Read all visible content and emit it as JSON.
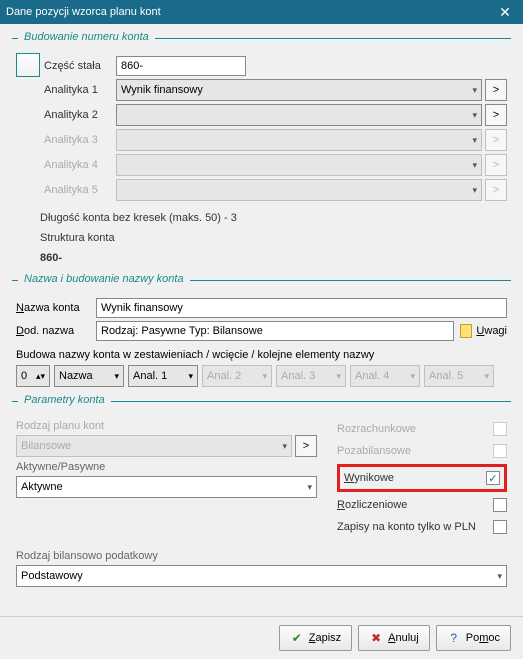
{
  "window": {
    "title": "Dane pozycji wzorca planu kont",
    "close": "✕"
  },
  "sec_build": {
    "legend": "Budowanie numeru konta",
    "const_lbl": "Część stała",
    "const_val": "860-",
    "ana1_lbl": "Analityka 1",
    "ana1_val": "Wynik finansowy",
    "ana2_lbl": "Analityka 2",
    "ana2_val": "",
    "ana3_lbl": "Analityka 3",
    "ana4_lbl": "Analityka 4",
    "ana5_lbl": "Analityka 5",
    "len_txt": "Długość konta bez kresek (maks. 50) -  3",
    "struct_lbl": "Struktura konta",
    "struct_val": "860-",
    "arrow": "▾",
    "go": ">"
  },
  "sec_name": {
    "legend": "Nazwa i budowanie nazwy konta",
    "name_lbl": "Nazwa konta",
    "name_val": "Wynik finansowy",
    "add_lbl": "Dod. nazwa",
    "add_val": "Rodzaj: Pasywne Typ: Bilansowe",
    "uwagi": "Uwagi",
    "build_txt": "Budowa nazwy konta w zestawieniach / wcięcie / kolejne elementy nazwy",
    "c0": "0",
    "c1": "Nazwa",
    "c2": "Anal. 1",
    "c3": "Anal. 2",
    "c4": "Anal. 3",
    "c5": "Anal. 4",
    "c6": "Anal. 5"
  },
  "sec_params": {
    "legend": "Parametry konta",
    "plan_lbl": "Rodzaj planu kont",
    "plan_val": "Bilansowe",
    "ap_lbl": "Aktywne/Pasywne",
    "ap_val": "Aktywne",
    "chk1": "Rozrachunkowe",
    "chk2": "Pozabilansowe",
    "chk3": "Wynikowe",
    "chk4": "Rozliczeniowe",
    "chk5": "Zapisy na konto tylko w PLN",
    "tax_lbl": "Rodzaj bilansowo podatkowy",
    "tax_val": "Podstawowy",
    "check": "✓"
  },
  "footer": {
    "save": "Zapisz",
    "cancel": "Anuluj",
    "help": "Pomoc"
  }
}
